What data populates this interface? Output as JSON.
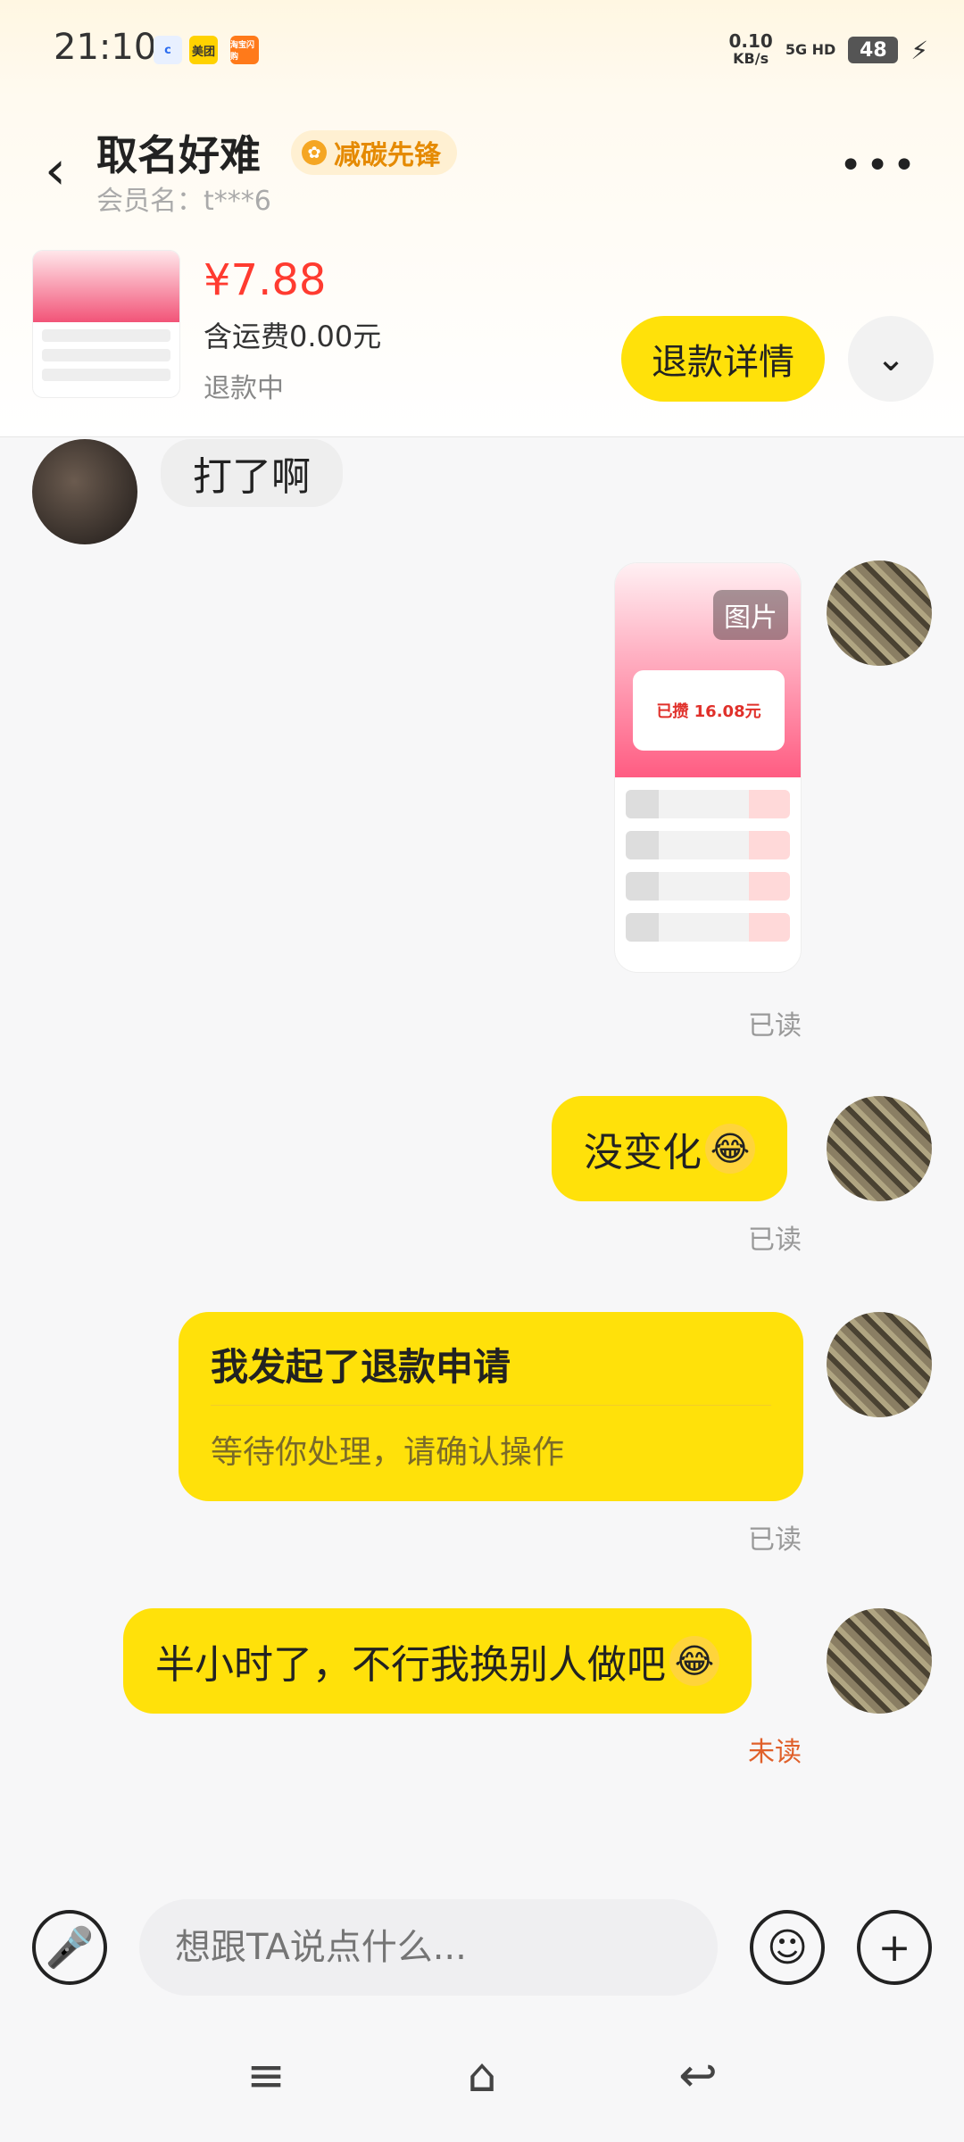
{
  "status_bar": {
    "time": "21:10",
    "apps": [
      "c",
      "美团",
      "淘宝闪购"
    ],
    "net_speed": "0.10",
    "net_unit": "KB/s",
    "signal": "5G HD",
    "battery": "48"
  },
  "header": {
    "title": "取名好难",
    "tag": "减碳先锋",
    "member": "会员名：t***6",
    "more_icon": "more-icon"
  },
  "order": {
    "price": "¥7.88",
    "shipping": "含运费0.00元",
    "status": "退款中",
    "refund_btn": "退款详情"
  },
  "messages": {
    "friend_text": "打了啊",
    "image_label": "图片",
    "image_amount": "已攒 16.08元",
    "read1": "已读",
    "msg2": "没变化",
    "read2": "已读",
    "card_title": "我发起了退款申请",
    "card_sub": "等待你处理，请确认操作",
    "read3": "已读",
    "msg4": "半小时了，不行我换别人做吧",
    "read4": "未读"
  },
  "input": {
    "placeholder": "想跟TA说点什么..."
  },
  "colors": {
    "accent": "#ffe10a",
    "price": "#ff3b30",
    "unread": "#e0602a"
  }
}
